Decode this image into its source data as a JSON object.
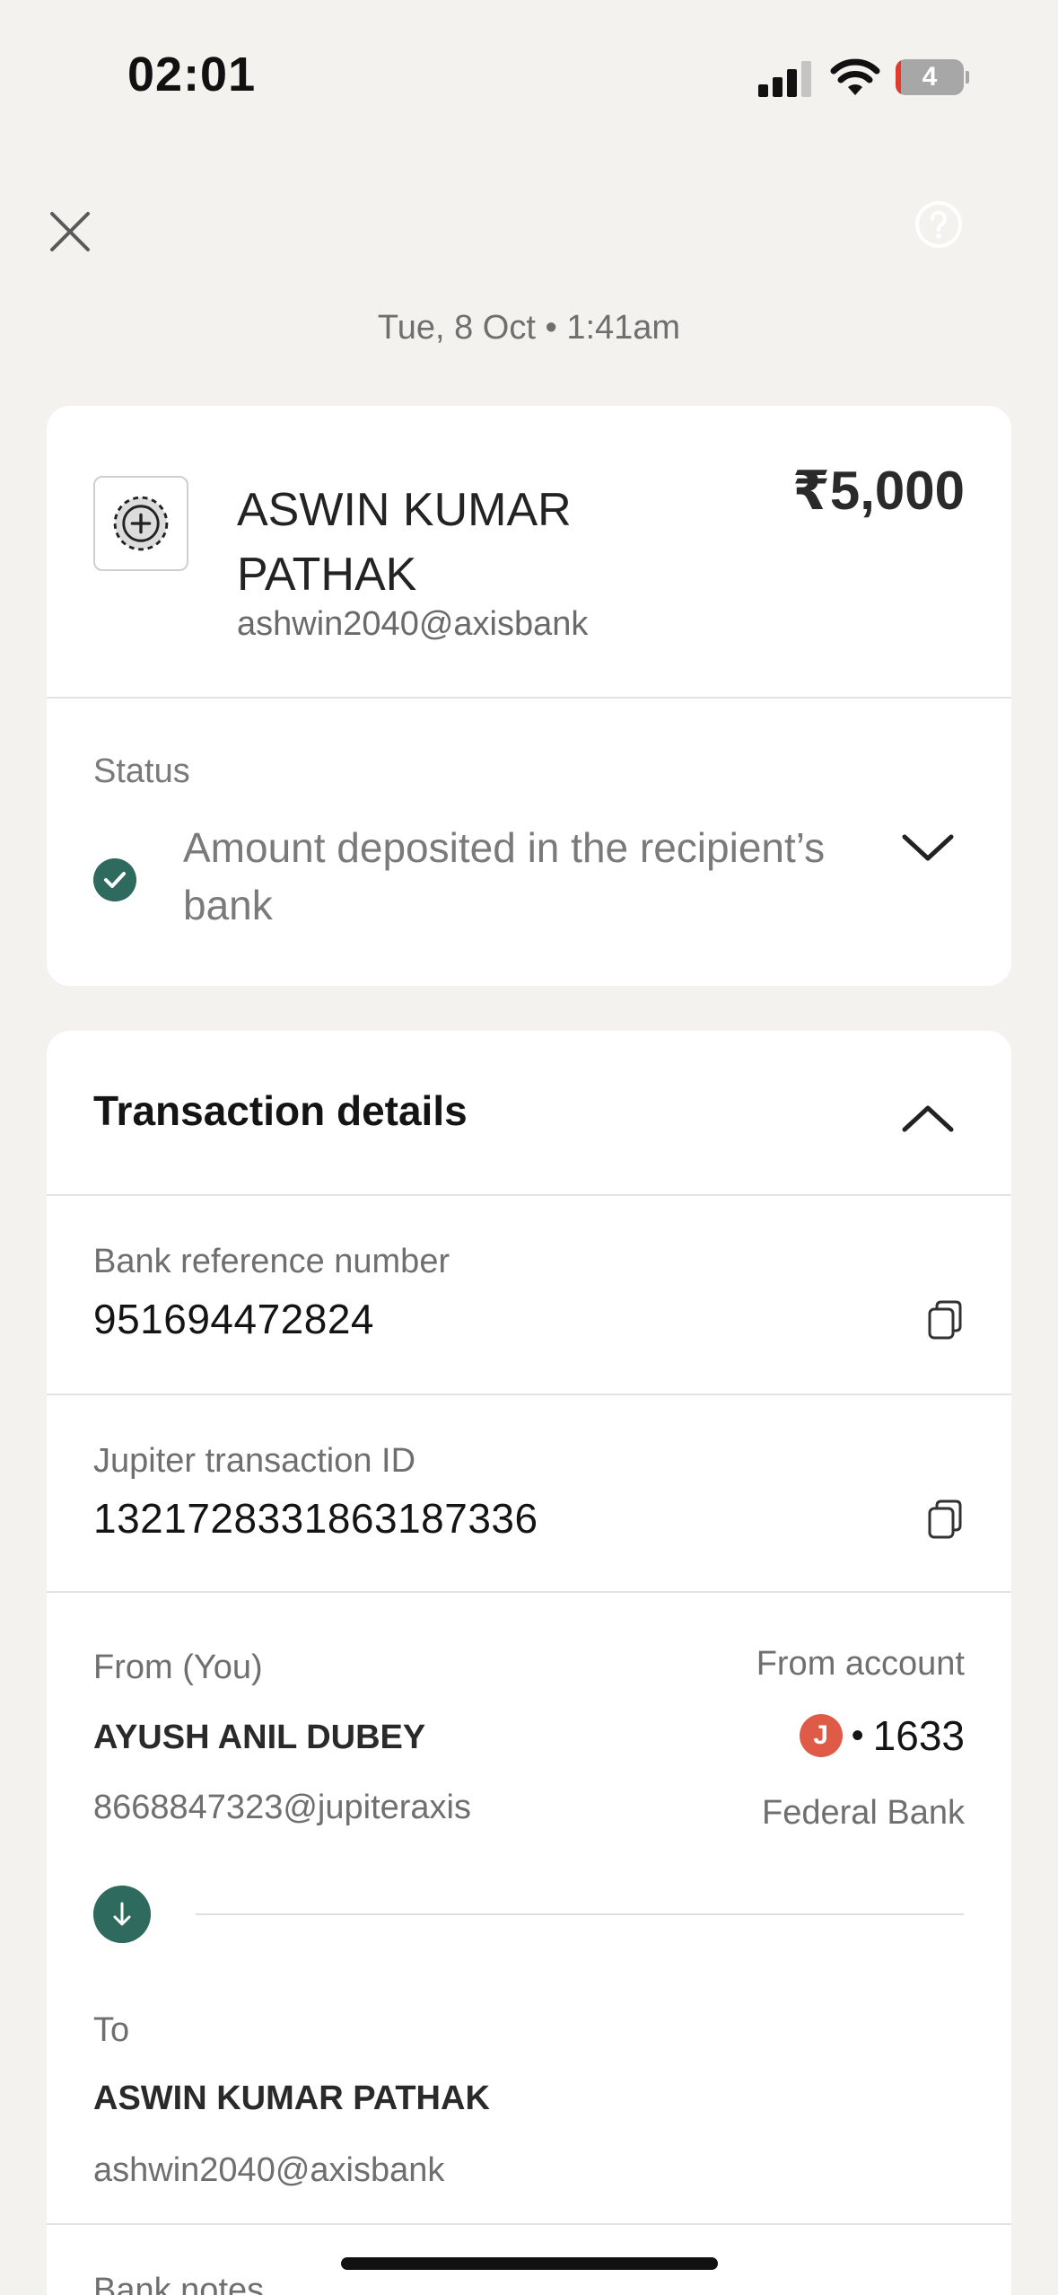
{
  "status_bar": {
    "time": "02:01",
    "battery_level": "4",
    "battery_fraction": 0.04,
    "signal_bars": 3,
    "signal_total": 4
  },
  "header": {
    "close_icon": "close-icon",
    "help_icon": "help-icon",
    "datetime": "Tue, 8 Oct • 1:41am"
  },
  "summary": {
    "recipient_name": "ASWIN KUMAR PATHAK",
    "recipient_upi": "ashwin2040@axisbank",
    "amount": "₹5,000",
    "status_label": "Status",
    "status_text": "Amount deposited in the recipient’s bank"
  },
  "details": {
    "title": "Transaction details",
    "bank_ref_label": "Bank reference number",
    "bank_ref_value": "951694472824",
    "jupiter_id_label": "Jupiter transaction ID",
    "jupiter_id_value": "1321728331863187336",
    "from_label": "From (You)",
    "from_name": "AYUSH ANIL DUBEY",
    "from_upi": "8668847323@jupiteraxis",
    "from_account_label": "From account",
    "bank_logo_letter": "J",
    "account_dot": "•",
    "account_last4": "1633",
    "bank_name": "Federal Bank",
    "to_label": "To",
    "to_name": "ASWIN KUMAR PATHAK",
    "to_upi": "ashwin2040@axisbank",
    "notes_label": "Bank notes"
  },
  "colors": {
    "background": "#f3f2ef",
    "success": "#2e6b5e",
    "bank_logo": "#e05a48",
    "battery_low": "#e23b2e"
  }
}
